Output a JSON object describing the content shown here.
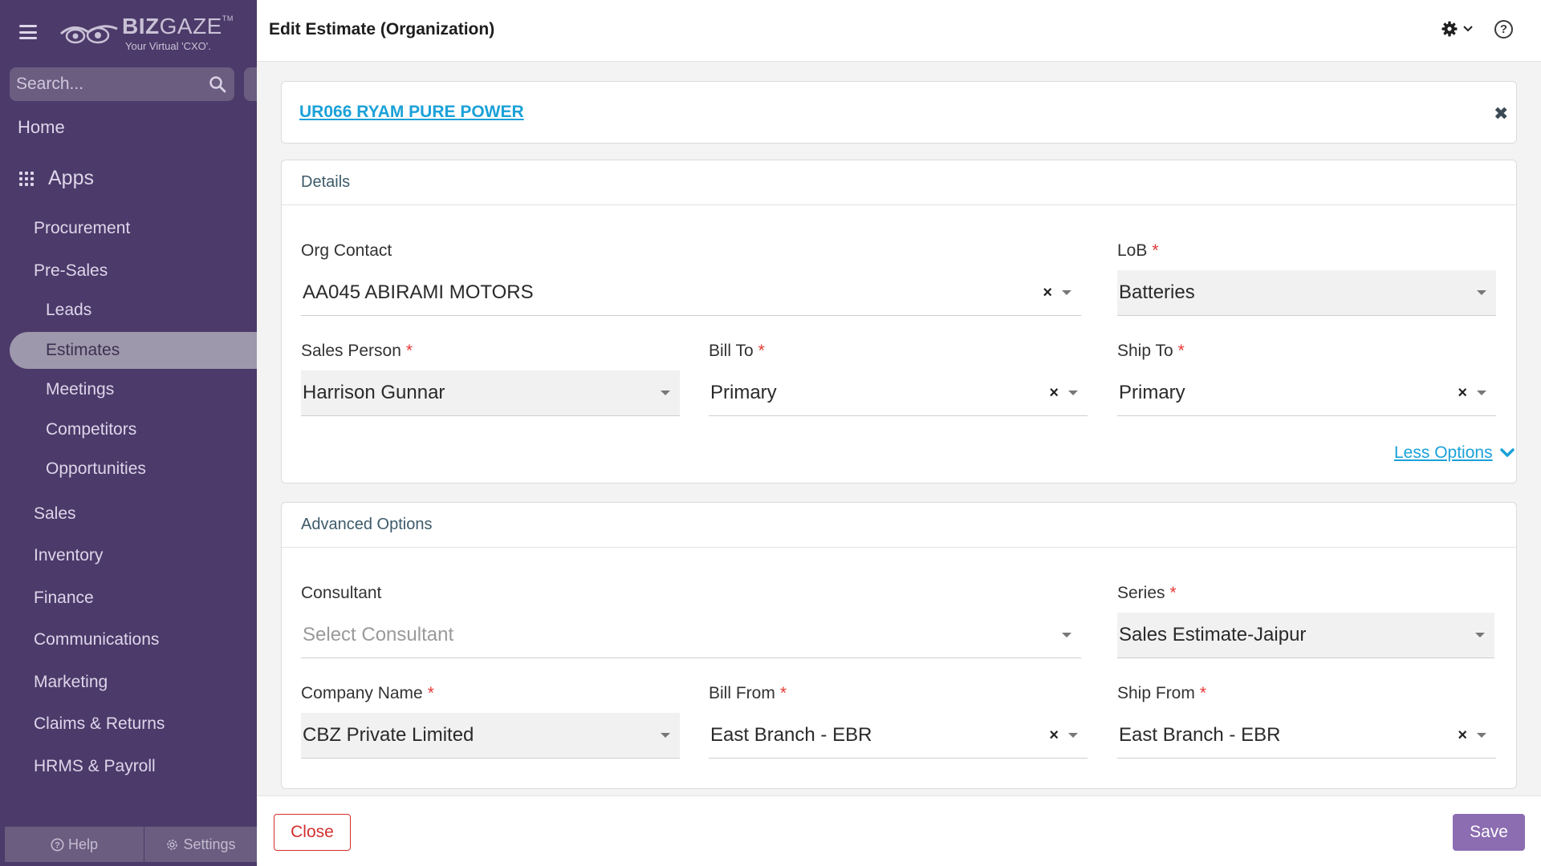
{
  "sidebar": {
    "logo": {
      "name_bold": "BIZ",
      "name_light": "GAZE",
      "tm": "TM",
      "tagline": "Your Virtual 'CXO'."
    },
    "search_placeholder": "Search...",
    "home": "Home",
    "apps": "Apps",
    "items": {
      "procurement": "Procurement",
      "presales": "Pre-Sales",
      "leads": "Leads",
      "estimates": "Estimates",
      "meetings": "Meetings",
      "competitors": "Competitors",
      "opportunities": "Opportunities",
      "sales": "Sales",
      "inventory": "Inventory",
      "finance": "Finance",
      "communications": "Communications",
      "marketing": "Marketing",
      "claims": "Claims & Returns",
      "hrms": "HRMS & Payroll"
    },
    "active_item": "Estimates",
    "footer": {
      "help": "Help",
      "settings": "Settings"
    }
  },
  "header": {
    "title": "Edit Estimate (Organization)"
  },
  "org": {
    "link": "UR066 RYAM PURE POWER",
    "close": "✖"
  },
  "details": {
    "title": "Details",
    "org_contact": {
      "label": "Org Contact",
      "value": "AA045 ABIRAMI MOTORS"
    },
    "lob": {
      "label": "LoB",
      "value": "Batteries"
    },
    "sales_person": {
      "label": "Sales Person",
      "value": "Harrison Gunnar"
    },
    "bill_to": {
      "label": "Bill To",
      "value": "Primary"
    },
    "ship_to": {
      "label": "Ship To",
      "value": "Primary"
    },
    "less_options": "Less Options"
  },
  "advanced": {
    "title": "Advanced Options",
    "consultant": {
      "label": "Consultant",
      "placeholder": "Select Consultant"
    },
    "series": {
      "label": "Series",
      "value": "Sales Estimate-Jaipur"
    },
    "company_name": {
      "label": "Company Name",
      "value": "CBZ Private Limited"
    },
    "bill_from": {
      "label": "Bill From",
      "value": "East Branch - EBR"
    },
    "ship_from": {
      "label": "Ship From",
      "value": "East Branch - EBR"
    }
  },
  "required_marker": "*",
  "clear_glyph": "×",
  "footer": {
    "close": "Close",
    "save": "Save"
  },
  "colors": {
    "sidebar_bg": "#4c3a6a",
    "accent_link": "#1aa1d8",
    "save_button": "#8c6db1",
    "close_button": "#d32f2f",
    "required": "#e53935"
  }
}
